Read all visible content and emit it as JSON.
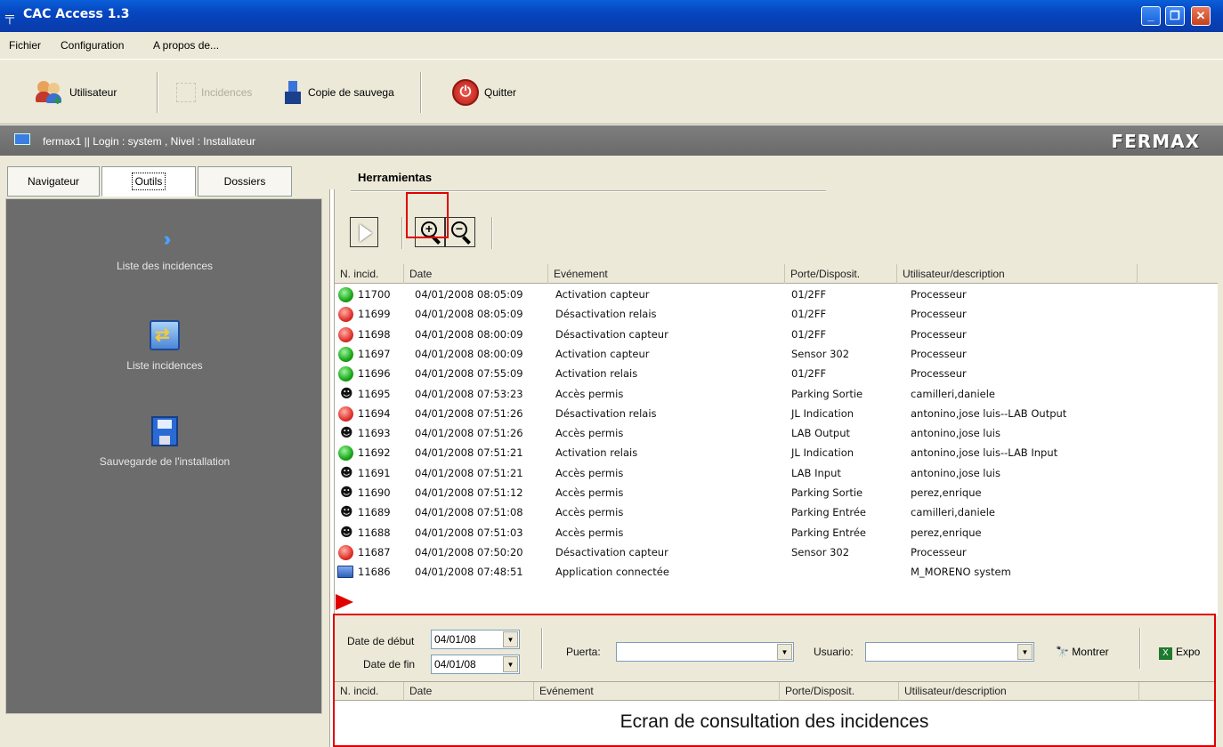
{
  "window": {
    "title": "CAC Access 1.3",
    "buttons": {
      "minimize": "_",
      "maximize": "❐",
      "close": "✕"
    }
  },
  "menu": [
    "Fichier",
    "Configuration",
    "A propos de..."
  ],
  "toolbar": {
    "users_label": "Utilisateur",
    "incidences_label": "Incidences",
    "backup_label": "Copie de sauvega",
    "quit_label": "Quitter"
  },
  "status": {
    "text": "fermax1  || Login : system , Nivel : Installateur",
    "logo": "FERMAX"
  },
  "tabs": [
    "Navigateur",
    "Outils",
    "Dossiers"
  ],
  "active_tab": "Outils",
  "nav": {
    "items": [
      {
        "label": "Liste des incidences",
        "icon": "chevron-double-right-icon"
      },
      {
        "label": "Liste incidences",
        "icon": "monitor-sync-icon"
      },
      {
        "label": "Sauvegarde de l'installation",
        "icon": "floppy-disk-icon"
      }
    ]
  },
  "panel": {
    "title": "Herramientas"
  },
  "table": {
    "columns": [
      "N. incid.",
      "Date",
      "Evénement",
      "Porte/Disposit.",
      "Utilisateur/description"
    ],
    "rows": [
      {
        "status": "green",
        "id": "11700",
        "date": "04/01/2008 08:05:09",
        "event": "Activation capteur",
        "door": "01/2FF",
        "user": "Processeur"
      },
      {
        "status": "red",
        "id": "11699",
        "date": "04/01/2008 08:05:09",
        "event": "Désactivation relais",
        "door": "01/2FF",
        "user": "Processeur"
      },
      {
        "status": "red",
        "id": "11698",
        "date": "04/01/2008 08:00:09",
        "event": "Désactivation capteur",
        "door": "01/2FF",
        "user": "Processeur"
      },
      {
        "status": "green",
        "id": "11697",
        "date": "04/01/2008 08:00:09",
        "event": "Activation capteur",
        "door": "Sensor 302",
        "user": "Processeur"
      },
      {
        "status": "green",
        "id": "11696",
        "date": "04/01/2008 07:55:09",
        "event": "Activation relais",
        "door": "01/2FF",
        "user": "Processeur"
      },
      {
        "status": "person",
        "id": "11695",
        "date": "04/01/2008 07:53:23",
        "event": "Accès permis",
        "door": "Parking Sortie",
        "user": "camilleri,daniele"
      },
      {
        "status": "red",
        "id": "11694",
        "date": "04/01/2008 07:51:26",
        "event": "Désactivation relais",
        "door": "JL Indication",
        "user": "antonino,jose luis--LAB Output"
      },
      {
        "status": "person",
        "id": "11693",
        "date": "04/01/2008 07:51:26",
        "event": "Accès permis",
        "door": "LAB Output",
        "user": "antonino,jose luis"
      },
      {
        "status": "green",
        "id": "11692",
        "date": "04/01/2008 07:51:21",
        "event": "Activation relais",
        "door": "JL Indication",
        "user": "antonino,jose luis--LAB Input"
      },
      {
        "status": "person",
        "id": "11691",
        "date": "04/01/2008 07:51:21",
        "event": "Accès permis",
        "door": "LAB Input",
        "user": "antonino,jose luis"
      },
      {
        "status": "person",
        "id": "11690",
        "date": "04/01/2008 07:51:12",
        "event": "Accès permis",
        "door": "Parking Sortie",
        "user": "perez,enrique"
      },
      {
        "status": "person",
        "id": "11689",
        "date": "04/01/2008 07:51:08",
        "event": "Accès permis",
        "door": "Parking Entrée",
        "user": "camilleri,daniele"
      },
      {
        "status": "person",
        "id": "11688",
        "date": "04/01/2008 07:51:03",
        "event": "Accès permis",
        "door": "Parking Entrée",
        "user": "perez,enrique"
      },
      {
        "status": "red",
        "id": "11687",
        "date": "04/01/2008 07:50:20",
        "event": "Désactivation capteur",
        "door": "Sensor 302",
        "user": "Processeur"
      },
      {
        "status": "pc",
        "id": "11686",
        "date": "04/01/2008 07:48:51",
        "event": "Application connectée",
        "door": "",
        "user": "M_MORENO system"
      }
    ]
  },
  "filters": {
    "start_label": "Date de début",
    "start_value": "04/01/08",
    "end_label": "Date de fin",
    "end_value": "04/01/08",
    "door_label": "Puerta:",
    "door_value": "",
    "user_label": "Usuario:",
    "user_value": "",
    "show_label": "Montrer",
    "export_label": "Expo"
  },
  "caption": "Ecran de consultation des incidences",
  "colors": {
    "title_bar": "#0546c0",
    "status_bar": "#6a6a6a",
    "highlight": "#e00000",
    "face": "#ece9d8"
  }
}
